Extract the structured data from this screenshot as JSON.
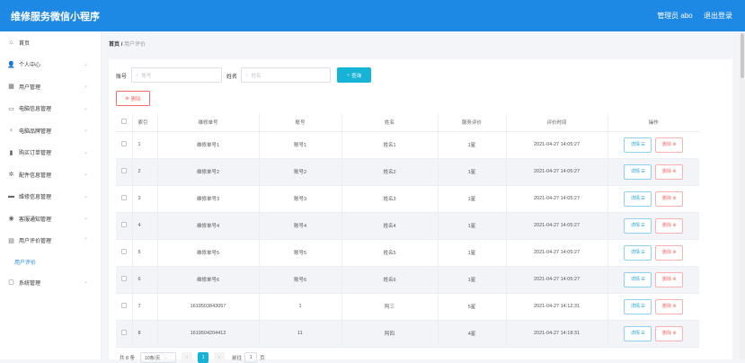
{
  "header": {
    "title": "维修服务微信小程序",
    "admin": "管理员 abo",
    "logout": "退出登录"
  },
  "sidebar": {
    "items": [
      {
        "icon": "⌂",
        "label": "首页",
        "chev": ""
      },
      {
        "icon": "👤",
        "label": "个人中心",
        "chev": "⌄"
      },
      {
        "icon": "▦",
        "label": "用户管理",
        "chev": "⌄"
      },
      {
        "icon": "▭",
        "label": "电脑信息管理",
        "chev": "⌄"
      },
      {
        "icon": "♀",
        "label": "电脑品牌管理",
        "chev": "⌄"
      },
      {
        "icon": "▮",
        "label": "购买订单管理",
        "chev": "⌄"
      },
      {
        "icon": "✲",
        "label": "配件信息管理",
        "chev": "⌄"
      },
      {
        "icon": "▬",
        "label": "维修信息管理",
        "chev": "⌄"
      },
      {
        "icon": "◉",
        "label": "客服通知管理",
        "chev": "⌄"
      },
      {
        "icon": "▤",
        "label": "用户评价管理",
        "chev": "⌃"
      }
    ],
    "sub_item": "用户评价",
    "last_item": {
      "icon": "▢",
      "label": "系统管理",
      "chev": "⌄"
    }
  },
  "breadcrumb": {
    "home": "首页",
    "sep": "/",
    "current": "用户评价"
  },
  "search": {
    "account_label": "账号",
    "account_placeholder": "账号",
    "name_label": "姓名",
    "name_placeholder": "姓名",
    "search_icon": "○",
    "query_label": "查询"
  },
  "batch_delete_label": "删除",
  "table": {
    "headers": [
      "索引",
      "维修单号",
      "账号",
      "姓名",
      "服务评价",
      "评价时间",
      "操作"
    ],
    "rows": [
      {
        "index": "1",
        "order": "维修单号1",
        "account": "账号1",
        "name": "姓名1",
        "rating": "1星",
        "time": "2021-04-27 14:05:27"
      },
      {
        "index": "2",
        "order": "维修单号2",
        "account": "账号2",
        "name": "姓名2",
        "rating": "1星",
        "time": "2021-04-27 14:05:27"
      },
      {
        "index": "3",
        "order": "维修单号3",
        "account": "账号3",
        "name": "姓名3",
        "rating": "1星",
        "time": "2021-04-27 14:05:27"
      },
      {
        "index": "4",
        "order": "维修单号4",
        "account": "账号4",
        "name": "姓名4",
        "rating": "1星",
        "time": "2021-04-27 14:05:27"
      },
      {
        "index": "5",
        "order": "维修单号5",
        "account": "账号5",
        "name": "姓名5",
        "rating": "1星",
        "time": "2021-04-27 14:05:27"
      },
      {
        "index": "6",
        "order": "维修单号6",
        "account": "账号6",
        "name": "姓名6",
        "rating": "1星",
        "time": "2021-04-27 14:05:27"
      },
      {
        "index": "7",
        "order": "1619503843057",
        "account": "1",
        "name": "阿三",
        "rating": "5星",
        "time": "2021-04-27 14:12:31"
      },
      {
        "index": "8",
        "order": "1619504204412",
        "account": "11",
        "name": "阿四",
        "rating": "4星",
        "time": "2021-04-27 14:18:31"
      }
    ],
    "detail_label": "详情 ☰",
    "delete_label": "删除 ⊗"
  },
  "pager": {
    "total": "共 8 条",
    "page_size": "10条/页",
    "prev": "‹",
    "current": "1",
    "next": "›",
    "goto": "前往",
    "goto_value": "1",
    "page_unit": "页"
  }
}
